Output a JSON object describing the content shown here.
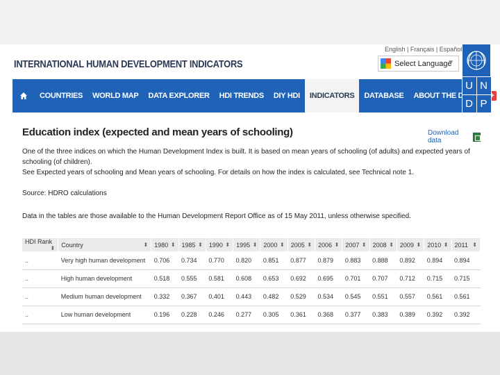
{
  "header": {
    "site_title": "INTERNATIONAL HUMAN DEVELOPMENT INDICATORS",
    "languages": [
      "English",
      "Français",
      "Español"
    ],
    "language_select": "Select Language"
  },
  "nav": {
    "items": [
      "COUNTRIES",
      "WORLD MAP",
      "DATA EXPLORER",
      "HDI TRENDS",
      "DIY HDI",
      "INDICATORS",
      "DATABASE",
      "ABOUT THE DATA"
    ],
    "active": "INDICATORS"
  },
  "logo": {
    "letters": [
      "U",
      "N",
      "D",
      "P"
    ]
  },
  "page": {
    "title": "Education index (expected and mean years of schooling)",
    "download_label": "Download data",
    "desc_line1": "One of the three indices on which the Human Development Index is built. It is based on mean years of schooling (of adults) and expected years of schooling (of children).",
    "desc_line2": "See Expected years of schooling and Mean years of schooling. For details on how the index is calculated, see Technical note 1.",
    "source": "Source: HDRO calculations",
    "note": "Data in the tables are those available to the Human Development Report Office as of 15 May 2011, unless otherwise specified."
  },
  "table": {
    "columns": [
      "HDI Rank",
      "Country",
      "1980",
      "1985",
      "1990",
      "1995",
      "2000",
      "2005",
      "2006",
      "2007",
      "2008",
      "2009",
      "2010",
      "2011"
    ],
    "rows": [
      [
        "..",
        "Very high human development",
        "0.706",
        "0.734",
        "0.770",
        "0.820",
        "0.851",
        "0.877",
        "0.879",
        "0.883",
        "0.888",
        "0.892",
        "0.894",
        "0.894"
      ],
      [
        "..",
        "High human development",
        "0.518",
        "0.555",
        "0.581",
        "0.608",
        "0.653",
        "0.692",
        "0.695",
        "0.701",
        "0.707",
        "0.712",
        "0.715",
        "0.715"
      ],
      [
        "..",
        "Medium human development",
        "0.332",
        "0.367",
        "0.401",
        "0.443",
        "0.482",
        "0.529",
        "0.534",
        "0.545",
        "0.551",
        "0.557",
        "0.561",
        "0.561"
      ],
      [
        "..",
        "Low human development",
        "0.196",
        "0.228",
        "0.246",
        "0.277",
        "0.305",
        "0.361",
        "0.368",
        "0.377",
        "0.383",
        "0.389",
        "0.392",
        "0.392"
      ]
    ]
  },
  "colors": {
    "nav_blue": "#1e63b8",
    "title_navy": "#2a3a56",
    "accent_red": "#e3413e"
  }
}
